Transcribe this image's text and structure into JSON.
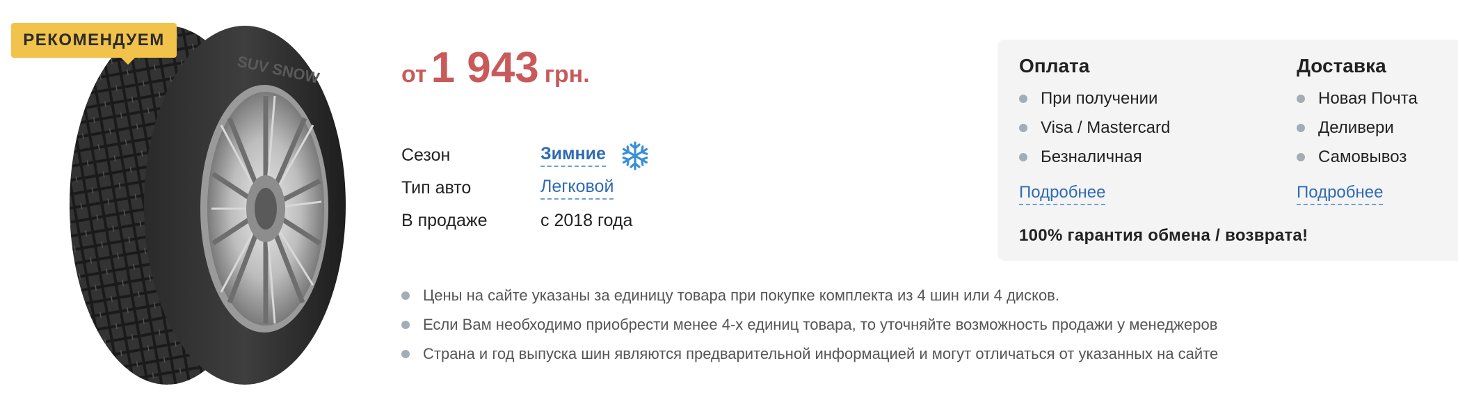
{
  "badge": "РЕКОМЕНДУЕМ",
  "tire": {
    "sidewall_text": "SUV SNOW"
  },
  "price": {
    "prefix": "от",
    "amount": "1 943",
    "currency": "грн."
  },
  "specs": [
    {
      "key": "Сезон",
      "value": "Зимние",
      "icon": "snowflake-icon"
    },
    {
      "key": "Тип авто",
      "value": "Легковой"
    },
    {
      "key": "В продаже",
      "value": "с 2018 года"
    }
  ],
  "payment": {
    "title": "Оплата",
    "items": [
      "При получении",
      "Visa / Mastercard",
      "Безналичная"
    ],
    "more": "Подробнее"
  },
  "delivery": {
    "title": "Доставка",
    "items": [
      "Новая Почта",
      "Деливери",
      "Самовывоз"
    ],
    "more": "Подробнее"
  },
  "guarantee": "100% гарантия обмена / возврата!",
  "notes": [
    "Цены на сайте указаны за единицу товара при покупке комплекта из 4 шин или 4 дисков.",
    "Если Вам необходимо приобрести менее 4-х единиц товара, то уточняйте возможность продажи у менеджеров",
    "Страна и год выпуска шин являются предварительной информацией и могут отличаться от указанных на сайте"
  ],
  "colors": {
    "price": "#c95a5a",
    "link": "#2f6bb5",
    "badge": "#f2c34a",
    "box": "#f4f4f4",
    "snowflake": "#3a8fd8"
  }
}
